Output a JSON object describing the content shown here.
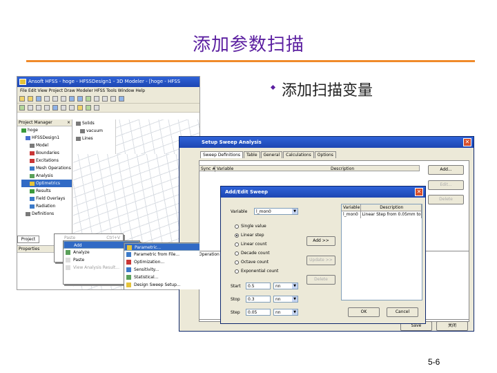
{
  "slide": {
    "title": "添加参数扫描",
    "bullet": "添加扫描变量",
    "page_number": "5-6",
    "colors": {
      "title": "#5b1fa0",
      "rule": "#f08a2a",
      "titlebar": "#2f63d8"
    }
  },
  "hfss_window": {
    "title": "Ansoft HFSS - hoge - HFSSDesign1 - 3D Modeler - [hoge - HFSS",
    "menu": "File  Edit  View  Project  Draw  Modeler  HFSS  Tools  Window  Help",
    "project_manager_label": "Project Manager",
    "tree": [
      {
        "label": "hoge",
        "icon": "project-icon"
      },
      {
        "label": "HFSSDesign1",
        "icon": "design-icon"
      },
      {
        "label": "Model",
        "icon": "model-icon"
      },
      {
        "label": "Boundaries",
        "icon": "boundary-icon"
      },
      {
        "label": "Excitations",
        "icon": "excitation-icon"
      },
      {
        "label": "Mesh Operations",
        "icon": "mesh-icon"
      },
      {
        "label": "Analysis",
        "icon": "analysis-icon"
      },
      {
        "label": "Optimetrics",
        "icon": "optimetrics-icon"
      },
      {
        "label": "Results",
        "icon": "results-icon"
      },
      {
        "label": "Field Overlays",
        "icon": "field-icon"
      },
      {
        "label": "Radiation",
        "icon": "radiation-icon"
      },
      {
        "label": "Definitions",
        "icon": "definitions-icon"
      }
    ],
    "history_tree": [
      "Solids",
      "vacuum",
      "Lines"
    ],
    "project_tab": "Project",
    "properties_label": "Properties",
    "context_menu_1": [
      {
        "label": "Paste",
        "shortcut": "Ctrl+V",
        "disabled": true
      },
      {
        "label": "Add",
        "selected": true
      },
      {
        "label": "Analyze"
      },
      {
        "label": "Paste"
      },
      {
        "label": "View Analysis Result..."
      }
    ],
    "context_menu_2": [
      {
        "label": "Parametric...",
        "selected": true
      },
      {
        "label": "Parametric from File..."
      },
      {
        "label": "Optimization..."
      },
      {
        "label": "Sensitivity..."
      },
      {
        "label": "Statistical..."
      },
      {
        "label": "Design Sweep Setup..."
      }
    ]
  },
  "sweep_dialog": {
    "title": "Setup Sweep Analysis",
    "tabs": [
      "Sweep Definitions",
      "Table",
      "General",
      "Calculations",
      "Options"
    ],
    "columns": [
      "Sync #",
      "Variable",
      "Description"
    ],
    "buttons": {
      "add": "Add...",
      "edit": "Edit...",
      "delete": "Delete",
      "save": "Save",
      "close": "关闭"
    },
    "lower_header": "Operation"
  },
  "add_edit_dialog": {
    "title": "Add/Edit Sweep",
    "variable_label": "Variable",
    "variable_value": "l_mon0",
    "sweep_types": [
      {
        "label": "Single value",
        "checked": false
      },
      {
        "label": "Linear step",
        "checked": true
      },
      {
        "label": "Linear count",
        "checked": false
      },
      {
        "label": "Decade count",
        "checked": false
      },
      {
        "label": "Octave count",
        "checked": false
      },
      {
        "label": "Exponential count",
        "checked": false
      }
    ],
    "start_label": "Start",
    "start_value": "0.5",
    "start_unit": "nn",
    "stop_label": "Stop",
    "stop_value": "0.3",
    "stop_unit": "nn",
    "step_label": "Step",
    "step_value": "0.05",
    "step_unit": "nn",
    "buttons": {
      "add": "Add >>",
      "update": "Update >>",
      "delete": "Delete",
      "ok": "OK",
      "cancel": "Cancel"
    },
    "table_columns": [
      "Variable",
      "Description"
    ],
    "table_rows": [
      {
        "variable": "l_mon0",
        "description": "Linear Step from 0.05mm to 0"
      }
    ]
  }
}
